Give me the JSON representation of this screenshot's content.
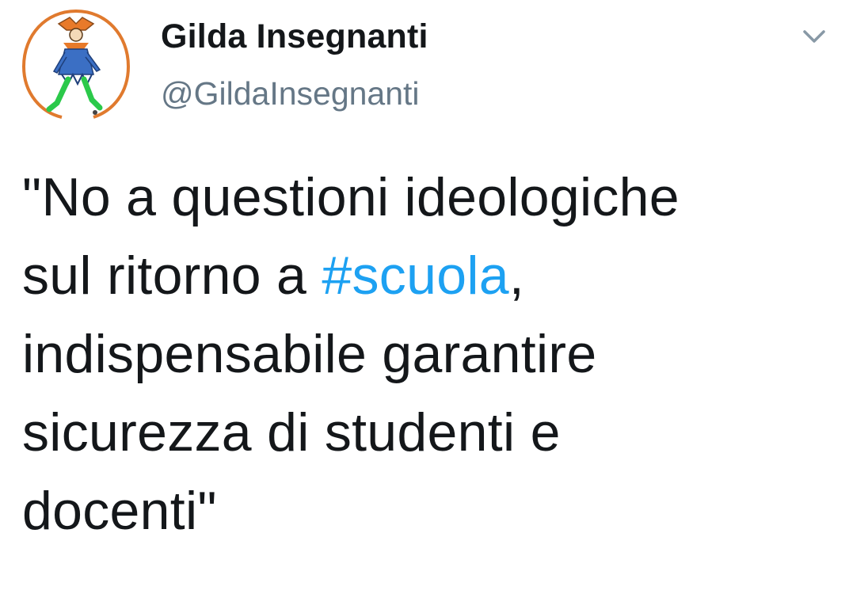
{
  "tweet": {
    "author": {
      "display_name": "Gilda Insegnanti",
      "handle": "@GildaInsegnanti",
      "avatar_icon": "jester-logo-icon"
    },
    "menu_icon": "chevron-down-icon",
    "text": {
      "before_hashtag": "\"No a questioni ideologiche\nsul ritorno a ",
      "hashtag": "#scuola",
      "after_hashtag": ",\nindispensabile garantire\nsicurezza di studenti e\ndocenti\""
    }
  },
  "colors": {
    "text": "#14171a",
    "secondary_text": "#657786",
    "link": "#1da1f2",
    "background": "#ffffff"
  }
}
